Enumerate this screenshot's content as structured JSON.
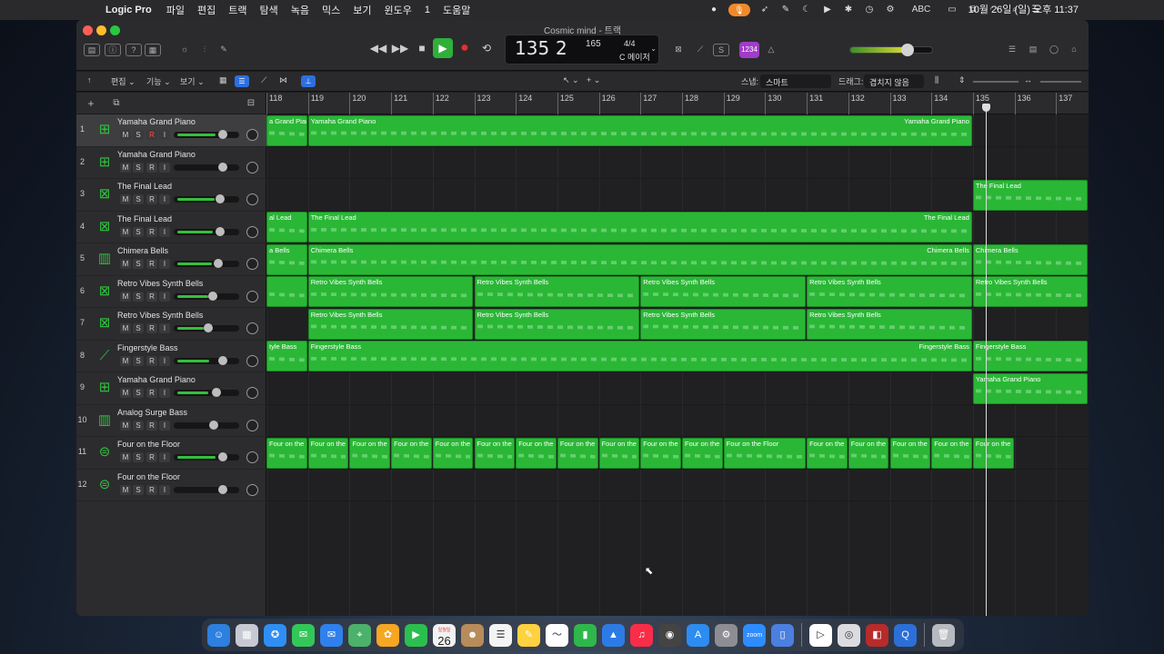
{
  "menubar": {
    "app_name": "Logic Pro",
    "items": [
      "파일",
      "편집",
      "트랙",
      "탐색",
      "녹음",
      "믹스",
      "보기",
      "윈도우",
      "1",
      "도움말"
    ],
    "clock": "10월 26일 (일) 오후 11:37",
    "input_source": "ABC"
  },
  "window": {
    "title": "Cosmic mind - 트랙"
  },
  "lcd": {
    "bar": "135",
    "beat": "2",
    "tempo": "165",
    "time_signature": "4/4",
    "key": "C 메이저"
  },
  "count_in_label": "1234",
  "edit_toolbar": {
    "edit_menu": "편집",
    "function_menu": "기능",
    "view_menu": "보기",
    "snap_label": "스냅:",
    "snap_value": "스마트",
    "drag_label": "드래그:",
    "drag_value": "겹치지 않음"
  },
  "ruler": {
    "bars": [
      "118",
      "119",
      "120",
      "121",
      "122",
      "123",
      "124",
      "125",
      "126",
      "127",
      "128",
      "129",
      "130",
      "131",
      "132",
      "133",
      "134",
      "135",
      "136",
      "137"
    ]
  },
  "tracks": [
    {
      "num": "1",
      "name": "Yamaha Grand Piano",
      "icon": "piano-icon",
      "selected": true,
      "rec_armed": true,
      "volume": 0.75,
      "meter": 0.72
    },
    {
      "num": "2",
      "name": "Yamaha Grand Piano",
      "icon": "piano-icon",
      "selected": false,
      "rec_armed": false,
      "volume": 0.75,
      "meter": 0
    },
    {
      "num": "3",
      "name": "The Final Lead",
      "icon": "synth-keyboard-icon",
      "selected": false,
      "rec_armed": false,
      "volume": 0.72,
      "meter": 0.7
    },
    {
      "num": "4",
      "name": "The Final Lead",
      "icon": "synth-keyboard-icon",
      "selected": false,
      "rec_armed": false,
      "volume": 0.72,
      "meter": 0.68
    },
    {
      "num": "5",
      "name": "Chimera Bells",
      "icon": "synth-icon",
      "selected": false,
      "rec_armed": false,
      "volume": 0.69,
      "meter": 0.66
    },
    {
      "num": "6",
      "name": "Retro Vibes Synth Bells",
      "icon": "synth-keyboard-icon",
      "selected": false,
      "rec_armed": false,
      "volume": 0.6,
      "meter": 0.58
    },
    {
      "num": "7",
      "name": "Retro Vibes Synth Bells",
      "icon": "synth-keyboard-icon",
      "selected": false,
      "rec_armed": false,
      "volume": 0.53,
      "meter": 0.5
    },
    {
      "num": "8",
      "name": "Fingerstyle Bass",
      "icon": "bass-guitar-icon",
      "selected": false,
      "rec_armed": false,
      "volume": 0.75,
      "meter": 0.6
    },
    {
      "num": "9",
      "name": "Yamaha Grand Piano",
      "icon": "piano-icon",
      "selected": false,
      "rec_armed": false,
      "volume": 0.66,
      "meter": 0.58
    },
    {
      "num": "10",
      "name": "Analog Surge Bass",
      "icon": "synth-icon",
      "selected": false,
      "rec_armed": false,
      "volume": 0.62,
      "meter": 0
    },
    {
      "num": "11",
      "name": "Four on the Floor",
      "icon": "drum-kit-icon",
      "selected": false,
      "rec_armed": false,
      "volume": 0.75,
      "meter": 0.72
    },
    {
      "num": "12",
      "name": "Four on the Floor",
      "icon": "drum-kit-icon",
      "selected": false,
      "rec_armed": false,
      "volume": 0.75,
      "meter": 0
    }
  ],
  "regions": [
    {
      "track": 0,
      "start": 118.0,
      "end": 119.0,
      "label": "a Grand Pian"
    },
    {
      "track": 0,
      "start": 119.0,
      "end": 135.0,
      "label": "Yamaha Grand Piano",
      "tail_label": "Yamaha Grand Piano"
    },
    {
      "track": 2,
      "start": 135.0,
      "end": 138.5,
      "label": "The Final Lead"
    },
    {
      "track": 3,
      "start": 118.0,
      "end": 119.0,
      "label": "al Lead"
    },
    {
      "track": 3,
      "start": 119.0,
      "end": 135.0,
      "label": "The Final Lead",
      "tail_label": "The Final Lead"
    },
    {
      "track": 4,
      "start": 118.0,
      "end": 119.0,
      "label": "a Bells"
    },
    {
      "track": 4,
      "start": 119.0,
      "end": 135.0,
      "label": "Chimera Bells",
      "tail_label": "Chimera Bells"
    },
    {
      "track": 4,
      "start": 135.0,
      "end": 138.5,
      "label": "Chimera Bells"
    },
    {
      "track": 5,
      "start": 118.0,
      "end": 119.0,
      "label": ""
    },
    {
      "track": 5,
      "start": 119.0,
      "end": 123.0,
      "label": "Retro Vibes Synth Bells"
    },
    {
      "track": 5,
      "start": 123.0,
      "end": 127.0,
      "label": "Retro Vibes Synth Bells"
    },
    {
      "track": 5,
      "start": 127.0,
      "end": 131.0,
      "label": "Retro Vibes Synth Bells"
    },
    {
      "track": 5,
      "start": 131.0,
      "end": 135.0,
      "label": "Retro Vibes Synth Bells"
    },
    {
      "track": 5,
      "start": 135.0,
      "end": 138.5,
      "label": "Retro Vibes Synth Bells"
    },
    {
      "track": 6,
      "start": 119.0,
      "end": 123.0,
      "label": "Retro Vibes Synth Bells"
    },
    {
      "track": 6,
      "start": 123.0,
      "end": 127.0,
      "label": "Retro Vibes Synth Bells"
    },
    {
      "track": 6,
      "start": 127.0,
      "end": 131.0,
      "label": "Retro Vibes Synth Bells"
    },
    {
      "track": 6,
      "start": 131.0,
      "end": 135.0,
      "label": "Retro Vibes Synth Bells"
    },
    {
      "track": 7,
      "start": 118.0,
      "end": 119.0,
      "label": "tyle Bass"
    },
    {
      "track": 7,
      "start": 119.0,
      "end": 135.0,
      "label": "Fingerstyle Bass",
      "tail_label": "Fingerstyle Bass"
    },
    {
      "track": 7,
      "start": 135.0,
      "end": 138.5,
      "label": "Fingerstyle Bass"
    },
    {
      "track": 8,
      "start": 135.0,
      "end": 138.5,
      "label": "Yamaha Grand Piano"
    },
    {
      "track": 10,
      "start": 118.0,
      "end": 119.0,
      "label": "Four on the"
    },
    {
      "track": 10,
      "start": 119.0,
      "end": 120.0,
      "label": "Four on the"
    },
    {
      "track": 10,
      "start": 120.0,
      "end": 121.0,
      "label": "Four on the"
    },
    {
      "track": 10,
      "start": 121.0,
      "end": 122.0,
      "label": "Four on the"
    },
    {
      "track": 10,
      "start": 122.0,
      "end": 123.0,
      "label": "Four on the"
    },
    {
      "track": 10,
      "start": 123.0,
      "end": 124.0,
      "label": "Four on the"
    },
    {
      "track": 10,
      "start": 124.0,
      "end": 125.0,
      "label": "Four on the"
    },
    {
      "track": 10,
      "start": 125.0,
      "end": 126.0,
      "label": "Four on the"
    },
    {
      "track": 10,
      "start": 126.0,
      "end": 127.0,
      "label": "Four on the"
    },
    {
      "track": 10,
      "start": 127.0,
      "end": 128.0,
      "label": "Four on the"
    },
    {
      "track": 10,
      "start": 128.0,
      "end": 129.0,
      "label": "Four on the"
    },
    {
      "track": 10,
      "start": 129.0,
      "end": 131.0,
      "label": "Four on the Floor"
    },
    {
      "track": 10,
      "start": 131.0,
      "end": 132.0,
      "label": "Four on the"
    },
    {
      "track": 10,
      "start": 132.0,
      "end": 133.0,
      "label": "Four on the"
    },
    {
      "track": 10,
      "start": 133.0,
      "end": 134.0,
      "label": "Four on the"
    },
    {
      "track": 10,
      "start": 134.0,
      "end": 135.0,
      "label": "Four on the"
    },
    {
      "track": 10,
      "start": 135.0,
      "end": 136.0,
      "label": "Four on the"
    }
  ],
  "playhead_bar": 135.3,
  "dock": {
    "calendar_month": "일월일",
    "calendar_day": "26",
    "icons": [
      "finder-icon",
      "launchpad-icon",
      "safari-icon",
      "messages-icon",
      "mail-icon",
      "maps-icon",
      "photos-icon",
      "facetime-icon",
      "calendar-icon",
      "contacts-icon",
      "reminders-icon",
      "notes-icon",
      "freeform-icon",
      "numbers-icon",
      "keynote-icon",
      "music-icon",
      "screenshot-icon",
      "app-store-icon",
      "system-settings-icon",
      "zoom-icon",
      "preview-icon",
      "play-icon",
      "logic-pro-icon",
      "mainstage-icon",
      "quicktime-icon",
      "trash-icon"
    ],
    "zoom_label": "zoom"
  },
  "colors": {
    "region_green": "#2ab736",
    "play_green": "#2fb03a",
    "record_red": "#e23030",
    "mic_orange": "#f08a2a"
  }
}
